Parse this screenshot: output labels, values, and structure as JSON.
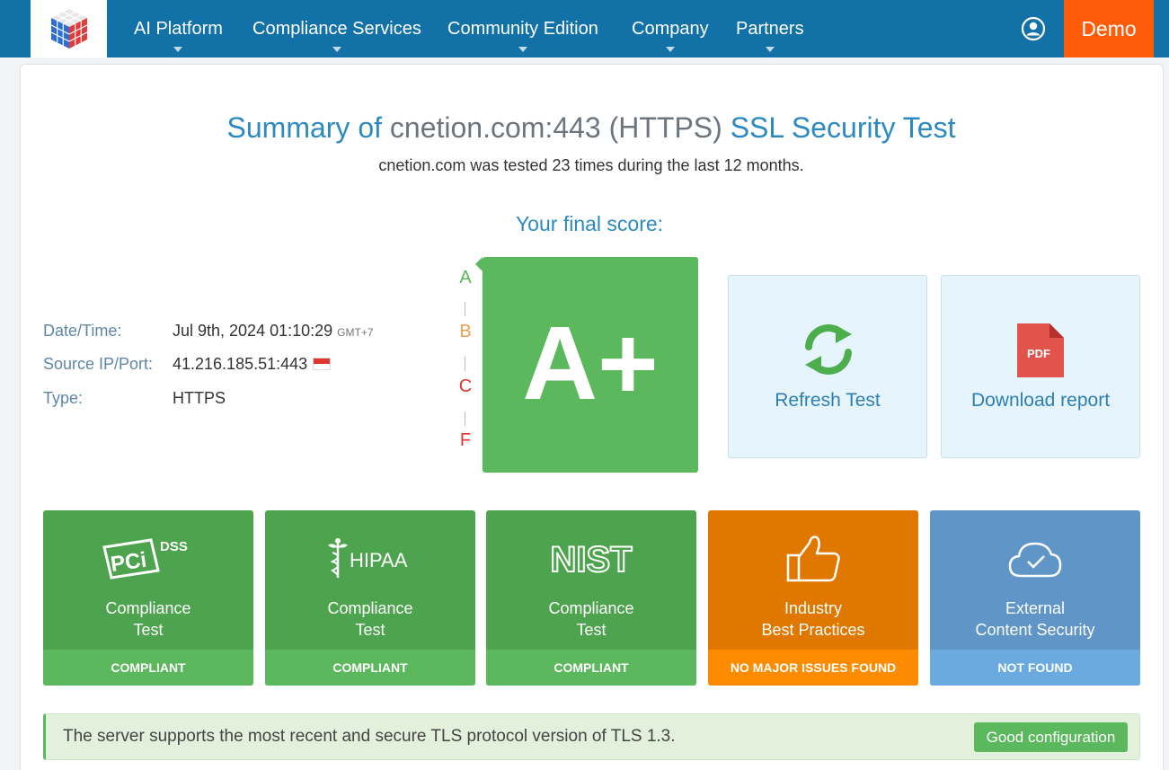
{
  "nav": {
    "items": [
      {
        "label": "AI Platform"
      },
      {
        "label": "Compliance Services"
      },
      {
        "label": "Community Edition"
      },
      {
        "label": "Company"
      },
      {
        "label": "Partners"
      }
    ],
    "user_icon": "user-circle-icon",
    "demo_label": "Demo",
    "colors": {
      "bar": "#1272a8",
      "demo": "#ff5c0a"
    }
  },
  "summary": {
    "title_prefix": "Summary of ",
    "host": "cnetion.com:443 (HTTPS)",
    "title_suffix": " SSL Security Test",
    "subtitle": "cnetion.com was tested 23 times during the last 12 months."
  },
  "score": {
    "label": "Your final score:",
    "grade": "A+",
    "scale": [
      "A",
      "B",
      "C",
      "F"
    ],
    "scale_colors": [
      "#5cb85c",
      "#f0a04b",
      "#e3352f",
      "#e3352f"
    ],
    "color": "#5cb85c"
  },
  "info": {
    "date_label": "Date/Time:",
    "date_value": "Jul 9th, 2024 01:10:29",
    "timezone": "GMT+7",
    "source_label": "Source IP/Port:",
    "source_value": "41.216.185.51:443",
    "flag": "singapore-flag",
    "type_label": "Type:",
    "type_value": "HTTPS"
  },
  "actions": {
    "refresh_label": "Refresh Test",
    "download_label": "Download report",
    "pdf_text": "PDF"
  },
  "compliance": [
    {
      "logo": "PCi",
      "logo_sup": "DSS",
      "title_line1": "Compliance",
      "title_line2": "Test",
      "status": "COMPLIANT"
    },
    {
      "logo": "HIPAA",
      "title_line1": "Compliance",
      "title_line2": "Test",
      "status": "COMPLIANT"
    },
    {
      "logo": "NIST",
      "title_line1": "Compliance",
      "title_line2": "Test",
      "status": "COMPLIANT"
    },
    {
      "logo": "thumbs-up-icon",
      "title_line1": "Industry",
      "title_line2": "Best Practices",
      "status": "NO MAJOR ISSUES FOUND"
    },
    {
      "logo": "cloud-check-icon",
      "title_line1": "External",
      "title_line2": "Content Security",
      "status": "NOT FOUND"
    }
  ],
  "alert": {
    "message": "The server supports the most recent and secure TLS protocol version of TLS 1.3.",
    "badge": "Good configuration"
  }
}
